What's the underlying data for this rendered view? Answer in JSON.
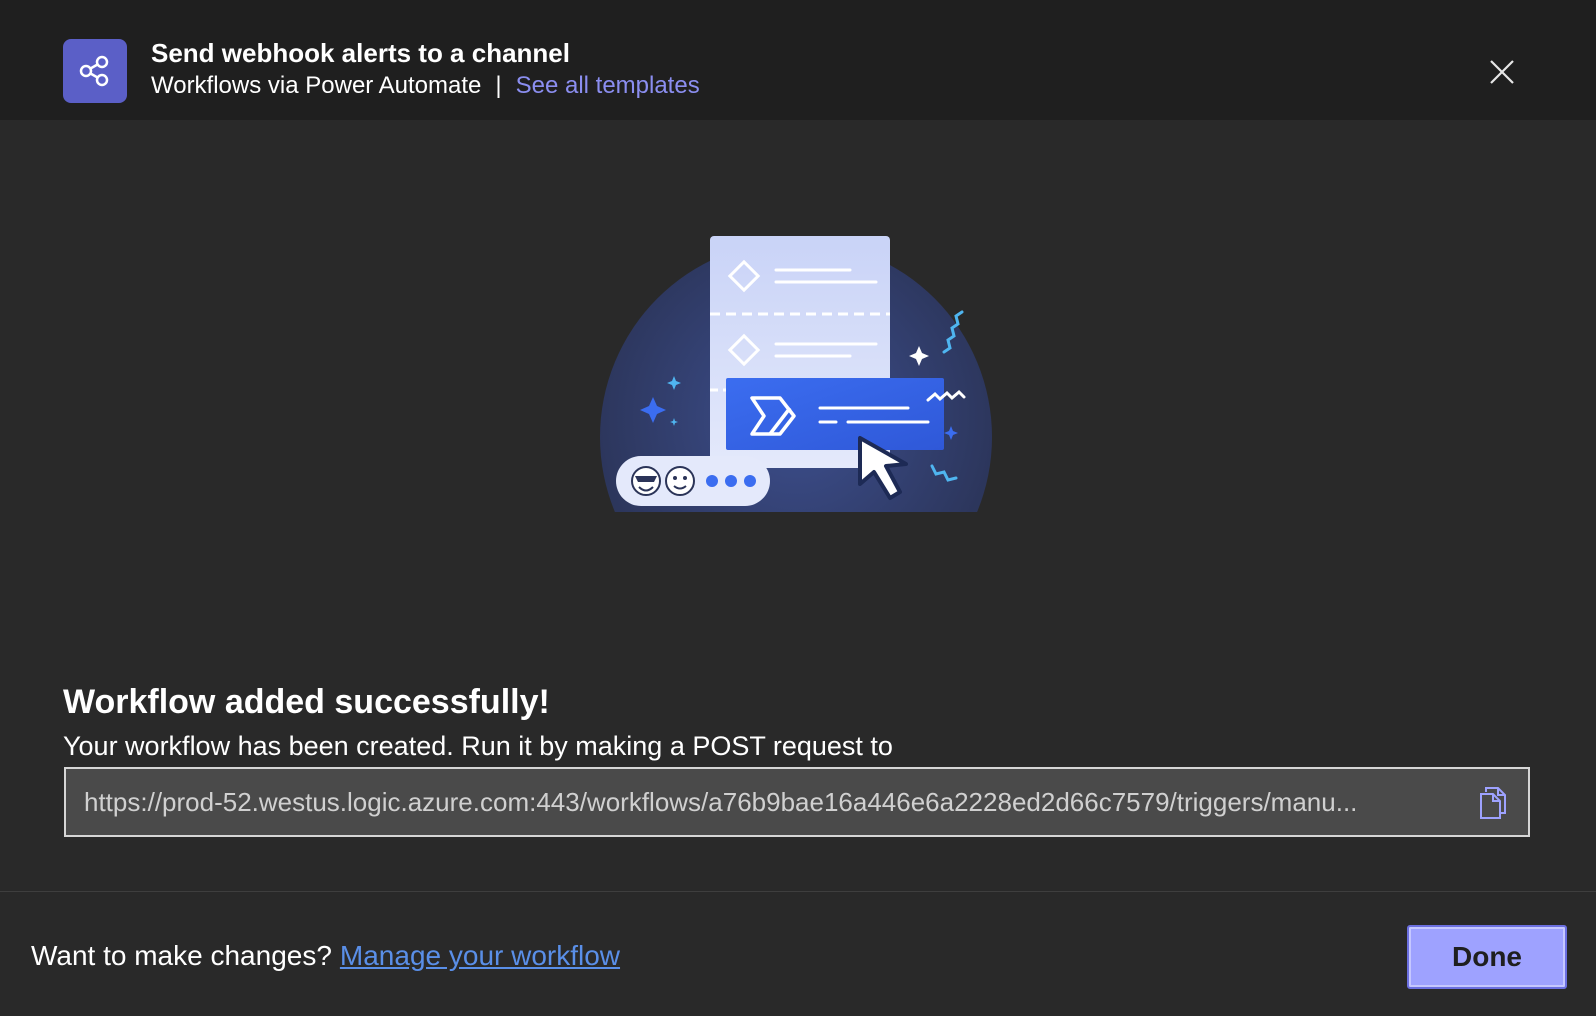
{
  "header": {
    "icon": "share-nodes-icon",
    "title": "Send webhook alerts to a channel",
    "subtitle": "Workflows via Power Automate",
    "separator": "|",
    "templates_link": "See all templates",
    "close_icon": "close-icon"
  },
  "illustration": {
    "name": "workflow-illustration"
  },
  "main": {
    "success_title": "Workflow added successfully!",
    "description": "Your workflow has been created. Run it by making a POST request to",
    "url": "https://prod-52.westus.logic.azure.com:443/workflows/a76b9bae16a446e6a2228ed2d66c7579/triggers/manu...",
    "copy_icon": "copy-icon"
  },
  "footer": {
    "prompt": "Want to make changes?",
    "manage_link": "Manage your workflow",
    "done_label": "Done"
  },
  "colors": {
    "accent": "#5b5fc7",
    "link": "#8b8ef0",
    "primary_button": "#9ea2ff",
    "background": "#292929"
  }
}
